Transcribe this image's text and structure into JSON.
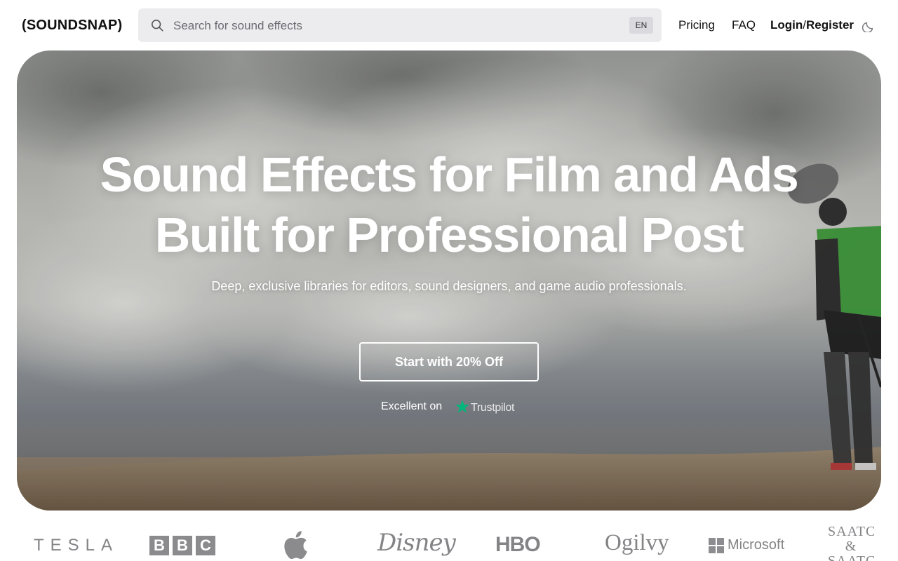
{
  "header": {
    "logo": "(SOUNDSNAP)",
    "search": {
      "placeholder": "Search for sound effects",
      "value": "",
      "language": "EN"
    },
    "nav": {
      "pricing": "Pricing",
      "faq": "FAQ",
      "login": "Login",
      "separator": "/",
      "register": "Register"
    },
    "theme_toggle_icon": "moon-icon"
  },
  "hero": {
    "title_line1": "Sound Effects for Film and Ads",
    "title_line2": "Built for Professional Post",
    "subtitle": "Deep, exclusive libraries for editors, sound designers, and game audio professionals.",
    "cta_label": "Start with 20% Off",
    "trust_text": "Excellent on",
    "trust_brand": "Trustpilot",
    "trust_star_color": "#00b67a"
  },
  "logos": {
    "tesla": "TESLA",
    "bbc": [
      "B",
      "B",
      "C"
    ],
    "apple_icon": "apple-logo-icon",
    "disney": "Disney",
    "hbo": "HBO",
    "ogilvy": "Ogilvy",
    "microsoft": "Microsoft",
    "saatchi": [
      "SAATCHI",
      "&",
      "SAATCHI"
    ]
  },
  "colors": {
    "text": "#111111",
    "search_bg": "#ececef",
    "logo_gray": "#6f6f73"
  }
}
